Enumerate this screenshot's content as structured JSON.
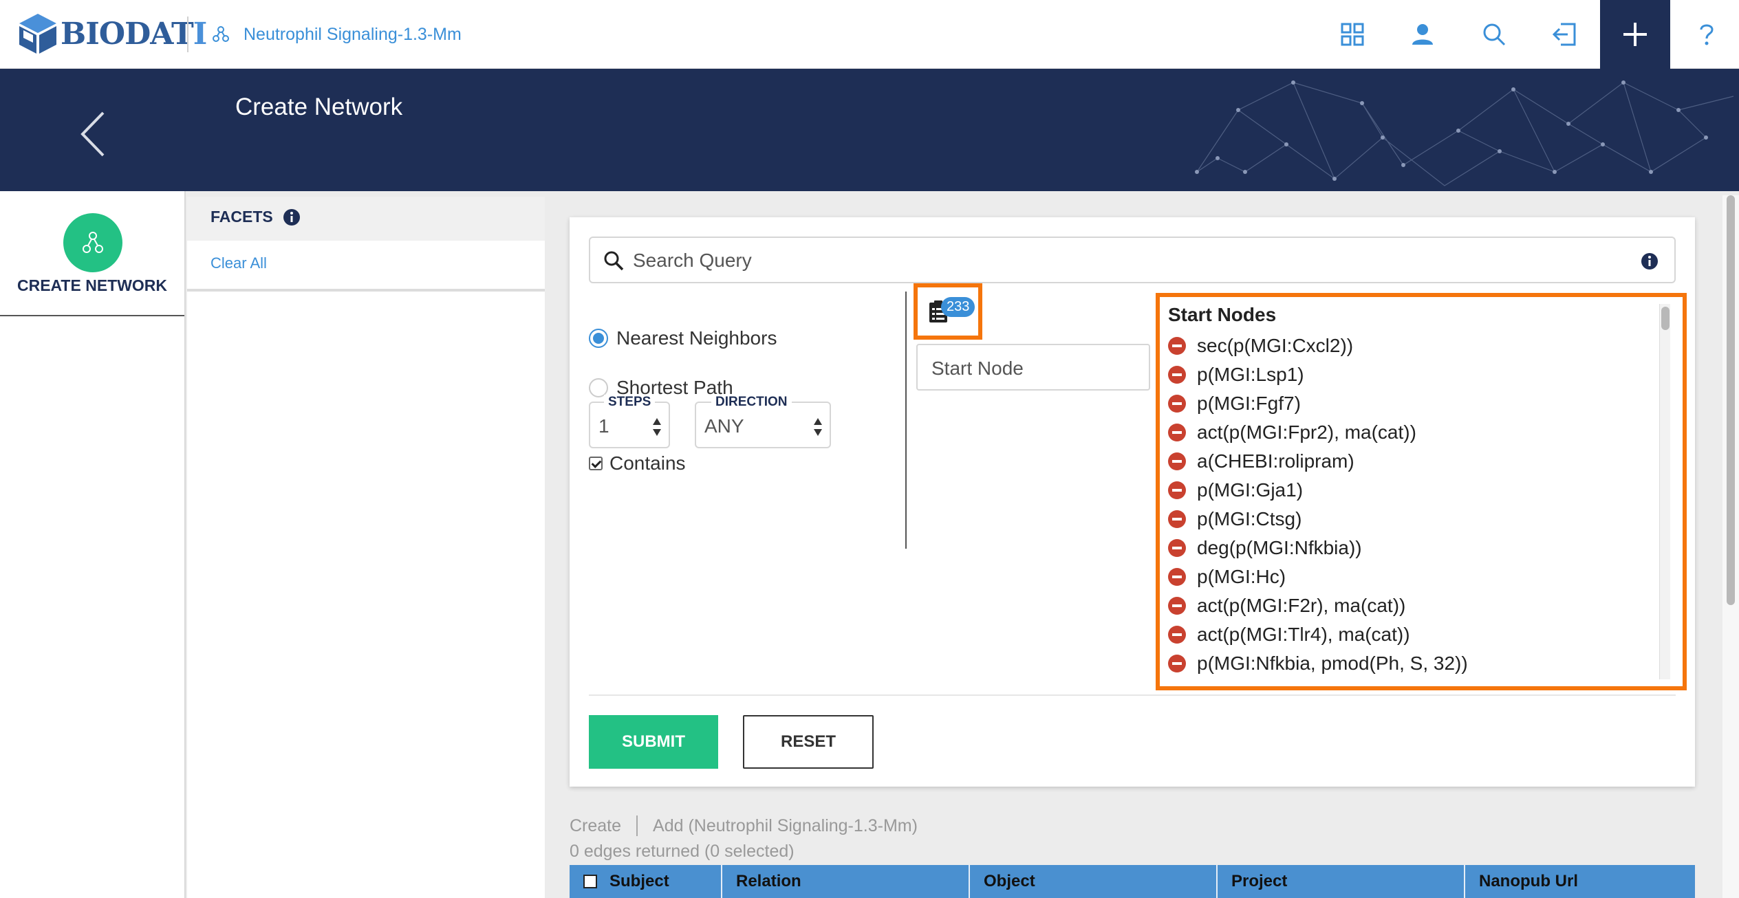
{
  "app": {
    "logo_text_main": "BIODAT",
    "logo_text_tail": "I",
    "project_name": "Neutrophil Signaling-1.3-Mm"
  },
  "topbar": {
    "icons": [
      "dashboard-grid-icon",
      "user-icon",
      "search-icon",
      "sign-out-icon",
      "plus-icon",
      "help-icon"
    ]
  },
  "header": {
    "title": "Create Network"
  },
  "leftnav": {
    "create_network_label": "CREATE NETWORK"
  },
  "facets": {
    "title": "FACETS",
    "clear_all": "Clear All"
  },
  "query": {
    "search_placeholder": "Search Query",
    "options": {
      "nearest_neighbors": "Nearest Neighbors",
      "shortest_path": "Shortest Path"
    },
    "selected_option": "Nearest Neighbors",
    "steps_label": "STEPS",
    "steps_value": "1",
    "direction_label": "DIRECTION",
    "direction_value": "ANY",
    "contains_label": "Contains",
    "contains_checked": true,
    "node_count": "233",
    "start_node_placeholder": "Start Node"
  },
  "start_nodes": {
    "title": "Start Nodes",
    "items": [
      "sec(p(MGI:Cxcl2))",
      "p(MGI:Lsp1)",
      "p(MGI:Fgf7)",
      "act(p(MGI:Fpr2), ma(cat))",
      "a(CHEBI:rolipram)",
      "p(MGI:Gja1)",
      "p(MGI:Ctsg)",
      "deg(p(MGI:Nfkbia))",
      "p(MGI:Hc)",
      "act(p(MGI:F2r), ma(cat))",
      "act(p(MGI:Tlr4), ma(cat))",
      "p(MGI:Nfkbia, pmod(Ph, S, 32))"
    ]
  },
  "actions": {
    "submit": "SUBMIT",
    "reset": "RESET"
  },
  "results": {
    "create_tab": "Create",
    "add_tab": "Add (Neutrophil Signaling-1.3-Mm)",
    "edges_info": "0 edges returned (0 selected)",
    "columns": [
      "Subject",
      "Relation",
      "Object",
      "Project",
      "Nanopub Url"
    ]
  },
  "colors": {
    "navy": "#1e2e55",
    "accent_green": "#23c184",
    "link_blue": "#3a8fd8",
    "highlight_orange": "#f5750c",
    "remove_red": "#c9412f",
    "table_header_blue": "#4a90d0"
  }
}
